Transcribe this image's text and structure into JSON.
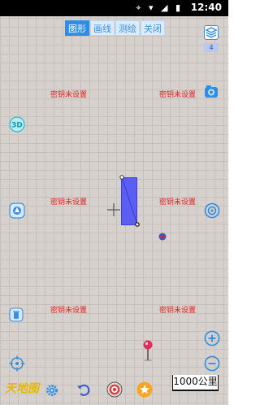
{
  "status_bar": {
    "time": "12:40",
    "icons": [
      "location-icon",
      "wifi-icon",
      "signal-icon",
      "battery-icon"
    ]
  },
  "tabs": [
    {
      "label": "图形",
      "active": true
    },
    {
      "label": "画线",
      "active": false
    },
    {
      "label": "测绘",
      "active": false
    },
    {
      "label": "关闭",
      "active": false
    }
  ],
  "layers": {
    "count": "4"
  },
  "map_tile_warning": "密钥未设置",
  "scale": {
    "label": "1000公里"
  },
  "brand": {
    "text": "天地图"
  },
  "colors": {
    "accent": "#2f8de6",
    "warning_text": "#e21f1f",
    "shape_fill": "#5b5df3",
    "map_background": "#d7d1cd"
  }
}
